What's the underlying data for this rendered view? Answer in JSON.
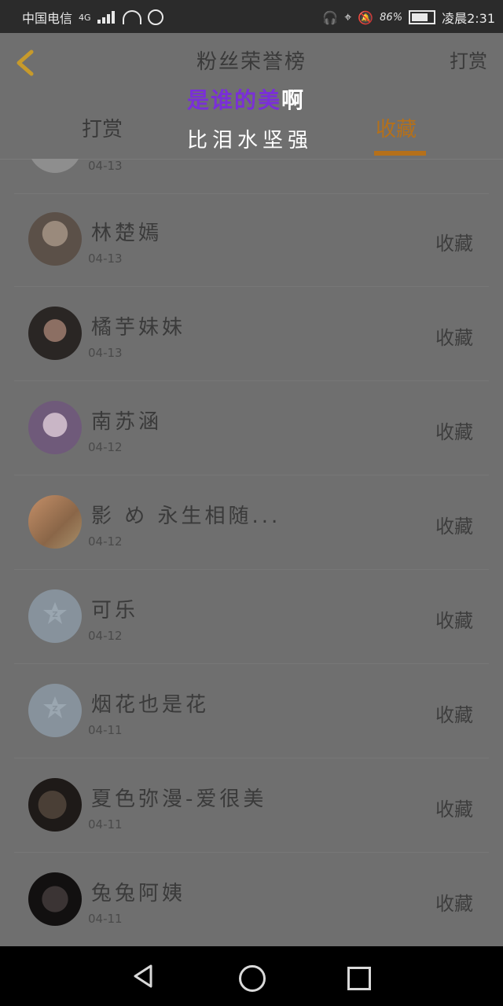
{
  "status_bar": {
    "carrier": "中国电信",
    "network": "4G",
    "battery_percent": "86%",
    "time": "凌晨2:31"
  },
  "header": {
    "title": "粉丝荣誉榜",
    "right_action": "打赏"
  },
  "overlay": {
    "line1_colored": "是谁的美",
    "line1_white": "啊",
    "line2": "比泪水坚强"
  },
  "tabs": [
    {
      "label": "打赏",
      "active": false
    },
    {
      "label": "收藏",
      "active": true
    }
  ],
  "list": {
    "partial_row_date": "04-13",
    "items": [
      {
        "name": "林楚嫣",
        "date": "04-13",
        "action": "收藏",
        "avatar": "av-girl1"
      },
      {
        "name": "橘芋妹妹",
        "date": "04-13",
        "action": "收藏",
        "avatar": "av-girl2"
      },
      {
        "name": "南苏涵",
        "date": "04-12",
        "action": "收藏",
        "avatar": "av-girl3"
      },
      {
        "name": "影 め 永生相随...",
        "date": "04-12",
        "action": "收藏",
        "avatar": "av-books"
      },
      {
        "name": "可乐",
        "date": "04-12",
        "action": "收藏",
        "avatar": "av-qq"
      },
      {
        "name": "烟花也是花",
        "date": "04-11",
        "action": "收藏",
        "avatar": "av-qq"
      },
      {
        "name": "夏色弥漫-爱很美",
        "date": "04-11",
        "action": "收藏",
        "avatar": "av-dark1"
      },
      {
        "name": "兔兔阿姨",
        "date": "04-11",
        "action": "收藏",
        "avatar": "av-dark2"
      }
    ]
  },
  "colors": {
    "accent": "#b5701a",
    "overlay_purple": "#7a2fd8",
    "dim_background": "#6f6f6f"
  }
}
